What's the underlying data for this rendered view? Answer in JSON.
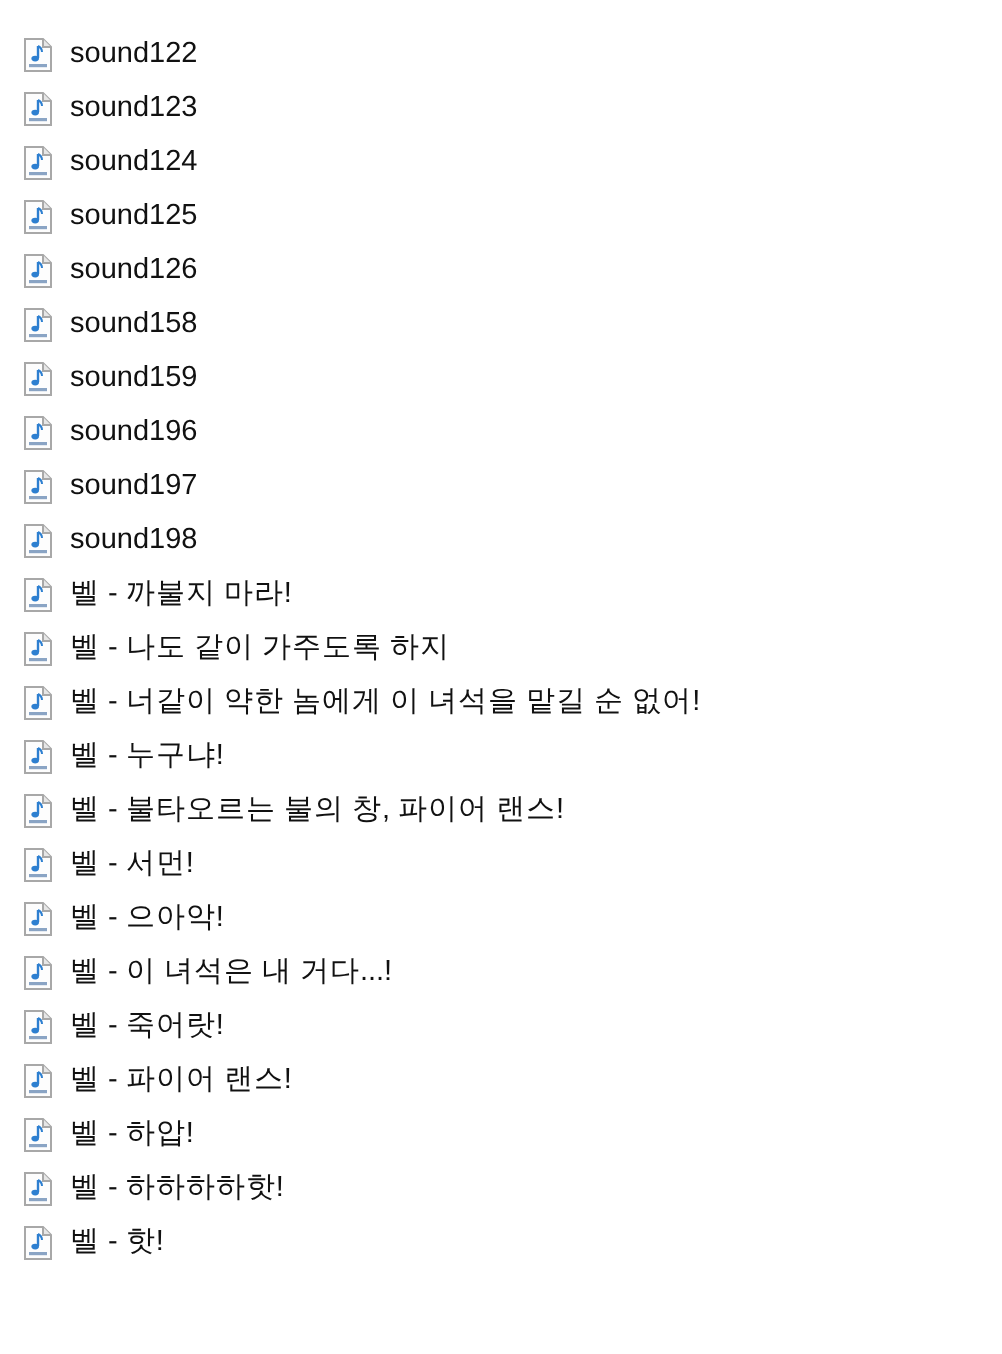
{
  "files": [
    {
      "name": "sound122"
    },
    {
      "name": "sound123"
    },
    {
      "name": "sound124"
    },
    {
      "name": "sound125"
    },
    {
      "name": "sound126"
    },
    {
      "name": "sound158"
    },
    {
      "name": "sound159"
    },
    {
      "name": "sound196"
    },
    {
      "name": "sound197"
    },
    {
      "name": "sound198"
    },
    {
      "name": "벨 - 까불지 마라!"
    },
    {
      "name": "벨 - 나도 같이 가주도록 하지"
    },
    {
      "name": "벨 - 너같이 약한 놈에게 이 녀석을 맡길 순 없어!"
    },
    {
      "name": "벨 - 누구냐!"
    },
    {
      "name": "벨 - 불타오르는 불의 창, 파이어 랜스!"
    },
    {
      "name": "벨 - 서먼!"
    },
    {
      "name": "벨 - 으아악!"
    },
    {
      "name": "벨 - 이 녀석은 내 거다...!"
    },
    {
      "name": "벨 - 죽어랏!"
    },
    {
      "name": "벨 - 파이어 랜스!"
    },
    {
      "name": "벨 - 하압!"
    },
    {
      "name": "벨 - 하하하하핫!"
    },
    {
      "name": "벨 - 핫!"
    }
  ]
}
